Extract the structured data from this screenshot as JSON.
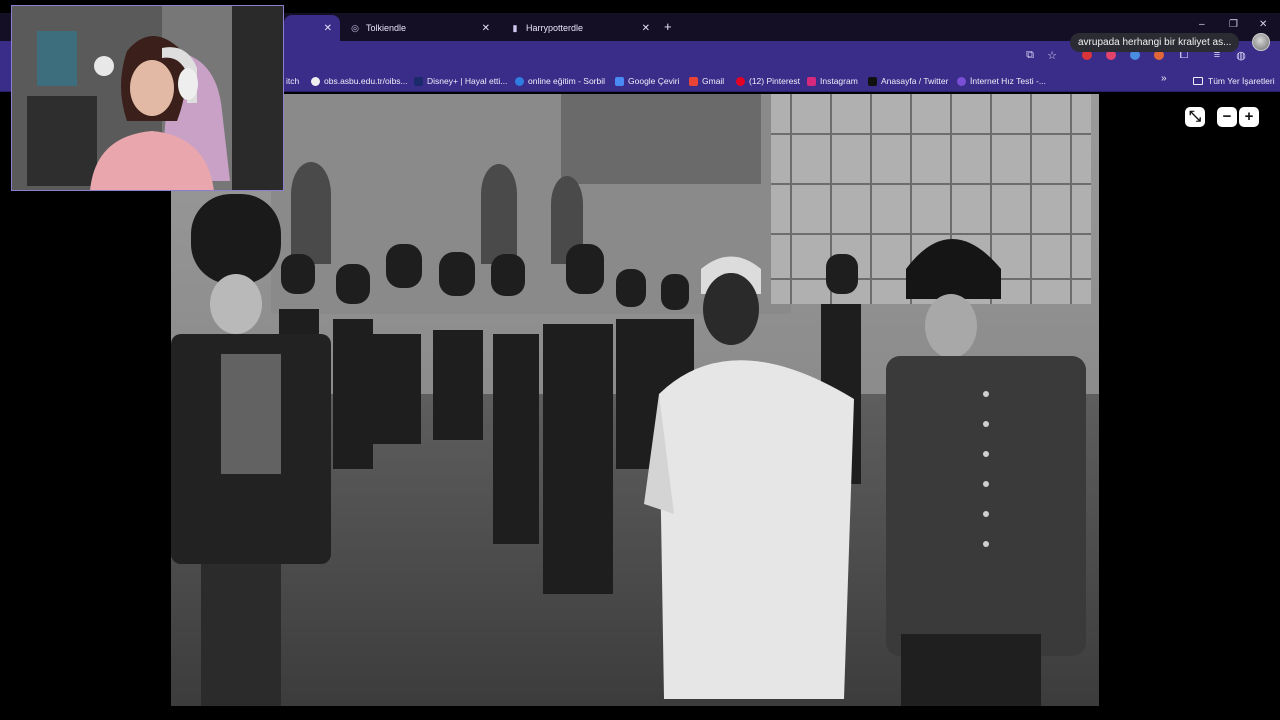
{
  "browser": {
    "tabs": [
      {
        "label": "",
        "active": true
      },
      {
        "label": "Tolkiendle",
        "active": false
      },
      {
        "label": "Harrypotterdle",
        "active": false
      }
    ],
    "tooltip": "avrupada herhangi bir kraliyet as...",
    "window_controls": [
      "–",
      "❐",
      "✕"
    ]
  },
  "bookmarks": {
    "items": [
      {
        "label": "itch",
        "icon": "twitch-icon"
      },
      {
        "label": "obs.asbu.edu.tr/oibs...",
        "icon": "globe-icon"
      },
      {
        "label": "Disney+ | Hayal etti...",
        "icon": "disney-icon"
      },
      {
        "label": "online eğitim - Sorbil",
        "icon": "globe-icon"
      },
      {
        "label": "Google Çeviri",
        "icon": "translate-icon"
      },
      {
        "label": "Gmail",
        "icon": "gmail-icon"
      },
      {
        "label": "(12) Pinterest",
        "icon": "pinterest-icon"
      },
      {
        "label": "Instagram",
        "icon": "instagram-icon"
      },
      {
        "label": "Anasayfa / Twitter",
        "icon": "x-icon"
      },
      {
        "label": "İnternet Hız Testi -...",
        "icon": "speedtest-icon"
      }
    ],
    "more": "»",
    "all_bookmarks": "Tüm Yer İşaretleri"
  },
  "viewer": {
    "minimize_label": "⤡",
    "zoom_out_label": "−",
    "zoom_in_label": "+",
    "photo_alt": "Black-and-white photo of a man in white robes reviewing a line of uniformed guards in busbies"
  },
  "colors": {
    "tab_strip": "#150f26",
    "toolbar": "#3a2d8a",
    "page_bg": "#000000"
  }
}
